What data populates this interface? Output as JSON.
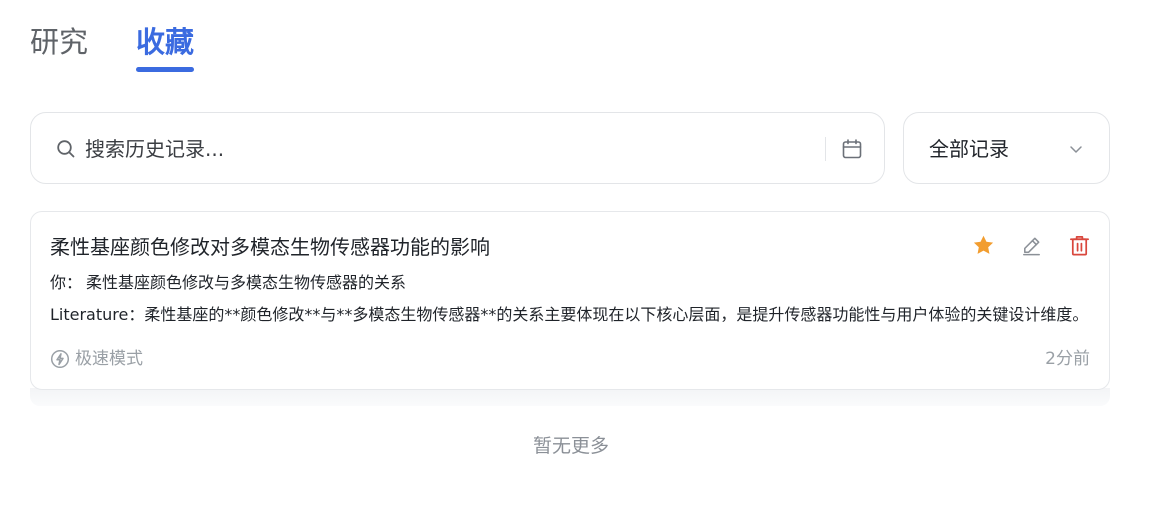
{
  "tabs": [
    {
      "label": "研究",
      "active": false
    },
    {
      "label": "收藏",
      "active": true
    }
  ],
  "search": {
    "placeholder": "搜索历史记录...",
    "value": "",
    "search_icon": "search-icon",
    "calendar_icon": "calendar-icon"
  },
  "filter": {
    "selected": "全部记录",
    "icon": "chevron-down-icon"
  },
  "records": [
    {
      "title": "柔性基座颜色修改对多模态生物传感器功能的影响",
      "user_label": "你：",
      "user_text": "柔性基座颜色修改与多模态生物传感器的关系",
      "reply_label": "Literature：",
      "reply_text": "柔性基座的**颜色修改**与**多模态生物传感器**的关系主要体现在以下核心层面，是提升传感器功能性与用户体验的关键设计维度。",
      "mode": "极速模式",
      "time": "2分前",
      "favorited": true,
      "actions": [
        "star-icon",
        "edit-icon",
        "delete-icon"
      ]
    }
  ],
  "footer": {
    "no_more": "暂无更多"
  },
  "colors": {
    "accent": "#3b6be0",
    "star": "#f29d2f",
    "delete": "#d9473d",
    "muted": "#9aa0a6"
  }
}
